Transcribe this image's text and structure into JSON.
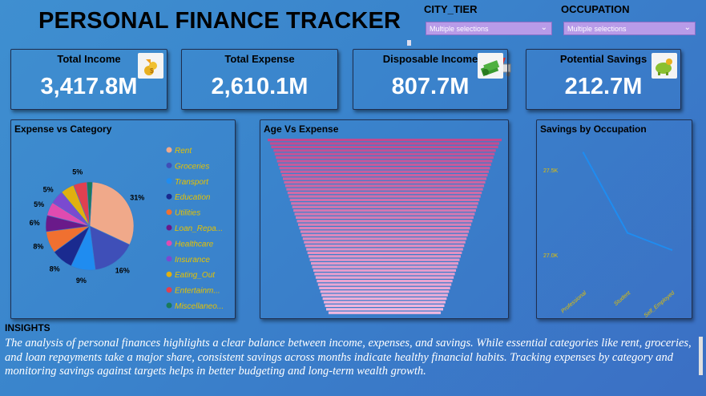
{
  "header": {
    "title": "PERSONAL FINANCE TRACKER"
  },
  "filters": [
    {
      "label": "CITY_TIER",
      "value": "Multiple selections"
    },
    {
      "label": "OCCUPATION",
      "value": "Multiple selections"
    }
  ],
  "kpis": [
    {
      "label": "Total Income",
      "value": "3,417.8M",
      "icon": "coins-hand-icon"
    },
    {
      "label": "Total Expense",
      "value": "2,610.1M",
      "icon": "shopping-cart-icon"
    },
    {
      "label": "Disposable Income",
      "value": "807.7M",
      "icon": "money-stack-icon"
    },
    {
      "label": "Potential Savings",
      "value": "212.7M",
      "icon": "piggy-bank-icon"
    }
  ],
  "colors": {
    "pie": [
      "#f0a98a",
      "#3f4fb8",
      "#1f8cf0",
      "#1a2a8f",
      "#f07030",
      "#6a1a8a",
      "#e04bb0",
      "#7a4ad0",
      "#e0b010",
      "#e04050",
      "#1a7a5a"
    ],
    "funnel": "#f0b4dc",
    "line": "#1f8cf0",
    "axis_text": "#e6c200"
  },
  "chart_data": [
    {
      "type": "pie",
      "title": "Expense vs Category",
      "categories": [
        "Rent",
        "Groceries",
        "Transport",
        "Education",
        "Utilities",
        "Loan_Repa...",
        "Healthcare",
        "Insurance",
        "Eating_Out",
        "Entertainm...",
        "Miscellaneo..."
      ],
      "values": [
        31,
        16,
        9,
        8,
        8,
        6,
        5,
        5,
        5,
        5,
        2
      ],
      "data_labels": [
        "31%",
        "16%",
        "9%",
        "8%",
        "8%",
        "6%",
        "5%",
        "5%",
        "",
        "5%",
        ""
      ],
      "legend": "right"
    },
    {
      "type": "bar",
      "title": "Age Vs Expense",
      "orientation": "funnel",
      "values": [
        100,
        98,
        97,
        95,
        94,
        93,
        92,
        91,
        90,
        89,
        88,
        87,
        86,
        85,
        84,
        83,
        82,
        81,
        80,
        79,
        78,
        77,
        76,
        75,
        74,
        73,
        72,
        71,
        70,
        69,
        68,
        67,
        66,
        65,
        64,
        63,
        62,
        61,
        60,
        59,
        58,
        57,
        56,
        55,
        54,
        53,
        52,
        51,
        50,
        48
      ]
    },
    {
      "type": "line",
      "title": "Savings by Occupation",
      "categories": [
        "Professional",
        "Student",
        "Self_Employed"
      ],
      "values": [
        27600,
        27130,
        27030
      ],
      "y_ticks": [
        "27.5K",
        "27.0K"
      ],
      "y_tick_values": [
        27500,
        27000
      ],
      "ylim": [
        26850,
        27650
      ],
      "grid": false
    }
  ],
  "insights": {
    "title": "INSIGHTS",
    "body": "The analysis of personal finances highlights a clear balance between income, expenses, and savings. While essential categories like rent, groceries, and loan repayments take a major share, consistent savings across months indicate healthy financial habits. Tracking expenses by category and monitoring savings against targets helps in better budgeting and long-term wealth growth."
  }
}
